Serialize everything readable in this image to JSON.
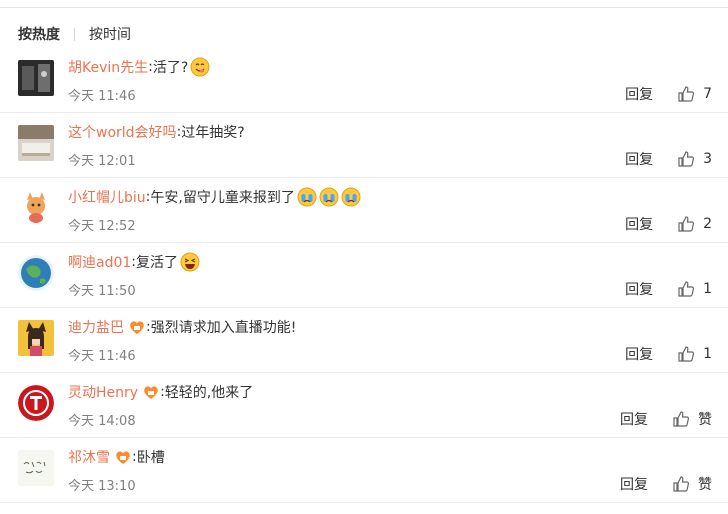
{
  "sort": {
    "hot": "按热度",
    "time": "按时间"
  },
  "actions": {
    "reply": "回复"
  },
  "comments": [
    {
      "user": "胡Kevin先生",
      "text": "活了?",
      "time": "今天 11:46",
      "likes": "7",
      "emoji": [
        "yum"
      ],
      "vip": false,
      "avatar": "photo-dark"
    },
    {
      "user": "这个world会好吗",
      "text": "过年抽奖?",
      "time": "今天 12:01",
      "likes": "3",
      "emoji": [],
      "vip": false,
      "avatar": "photo-desk"
    },
    {
      "user": "小红帽儿biu",
      "text": "午安,留守儿童来报到了",
      "time": "今天 12:52",
      "likes": "2",
      "emoji": [
        "cry",
        "cry",
        "cry"
      ],
      "vip": false,
      "avatar": "cartoon-fox"
    },
    {
      "user": "啊迪ad01",
      "text": "复活了",
      "time": "今天 11:50",
      "likes": "1",
      "emoji": [
        "laugh"
      ],
      "vip": false,
      "avatar": "earth-globe"
    },
    {
      "user": "迪力盐巴",
      "text": "强烈请求加入直播功能!",
      "time": "今天 11:46",
      "likes": "1",
      "emoji": [],
      "vip": true,
      "avatar": "girl-cat-ears"
    },
    {
      "user": "灵动Henry",
      "text": "轻轻的,他来了",
      "time": "今天 14:08",
      "likes": "赞",
      "emoji": [],
      "vip": true,
      "avatar": "red-letter-t"
    },
    {
      "user": "祁沐雪",
      "text": "卧槽",
      "time": "今天 13:10",
      "likes": "赞",
      "emoji": [],
      "vip": true,
      "avatar": "handwriting"
    }
  ],
  "colors": {
    "username": "#eb7350",
    "meta": "#808080",
    "divider": "#ececec"
  }
}
